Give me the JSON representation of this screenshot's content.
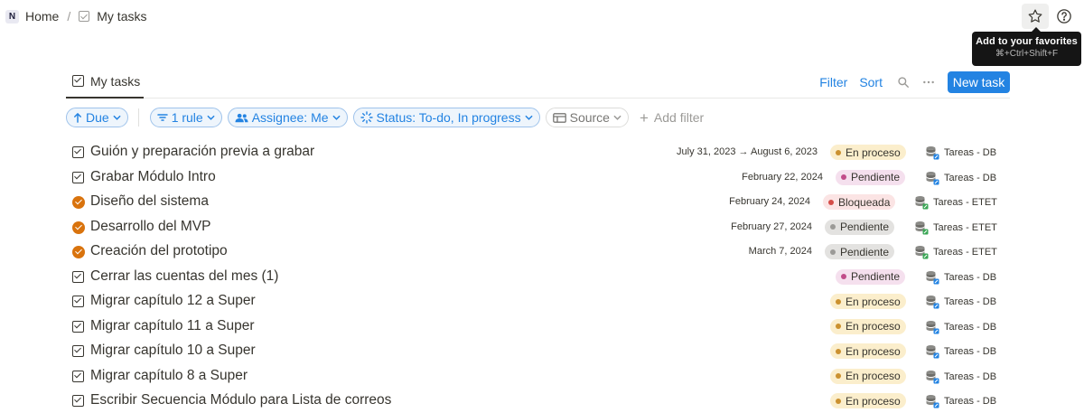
{
  "breadcrumb": {
    "logo": "N",
    "home": "Home",
    "separator": "/",
    "current": "My tasks"
  },
  "tooltip": {
    "title": "Add to your favorites",
    "shortcut": "⌘+Ctrl+Shift+F"
  },
  "view": {
    "tab_label": "My tasks",
    "filter_label": "Filter",
    "sort_label": "Sort",
    "new_task_label": "New task"
  },
  "filters": {
    "sort": "Due",
    "rule": "1 rule",
    "assignee": "Assignee: Me",
    "status": "Status: To-do, In progress",
    "source": "Source",
    "add_filter": "Add filter"
  },
  "colors": {
    "accent": "#2383e2",
    "en_proceso_bg": "#fbeecc",
    "en_proceso_dot": "#cb912f",
    "pendiente_bg": "#f5e0ee",
    "pendiente_dot": "#c14c8a",
    "bloqueada_bg": "#fbe4e4",
    "bloqueada_dot": "#d44c47",
    "pendiente_grey_bg": "#e3e2e0",
    "pendiente_grey_dot": "#9b9a97",
    "task_done_orange": "#d9730d"
  },
  "tasks": [
    {
      "title": "Guión y preparación previa a grabar",
      "icon": "checkbox-icon",
      "date": "July 31, 2023 → August 6, 2023",
      "status": "En proceso",
      "status_style": "en_proceso",
      "source": "Tareas - DB"
    },
    {
      "title": "Grabar Módulo Intro",
      "icon": "checkbox-icon",
      "date": "February 22, 2024",
      "status": "Pendiente",
      "status_style": "pendiente",
      "source": "Tareas - DB"
    },
    {
      "title": "Diseño del sistema",
      "icon": "orange-check-circle-icon",
      "date": "February 24, 2024",
      "status": "Bloqueada",
      "status_style": "bloqueada",
      "source": "Tareas - ETET"
    },
    {
      "title": "Desarrollo del MVP",
      "icon": "orange-check-circle-icon",
      "date": "February 27, 2024",
      "status": "Pendiente",
      "status_style": "pendiente_grey",
      "source": "Tareas - ETET"
    },
    {
      "title": "Creación del prototipo",
      "icon": "orange-check-circle-icon",
      "date": "March 7, 2024",
      "status": "Pendiente",
      "status_style": "pendiente_grey",
      "source": "Tareas - ETET"
    },
    {
      "title": "Cerrar las cuentas del mes (1)",
      "icon": "checkbox-icon",
      "date": "",
      "status": "Pendiente",
      "status_style": "pendiente",
      "source": "Tareas - DB"
    },
    {
      "title": "Migrar capítulo 12 a Super",
      "icon": "checkbox-icon",
      "date": "",
      "status": "En proceso",
      "status_style": "en_proceso",
      "source": "Tareas - DB"
    },
    {
      "title": "Migrar capítulo 11 a Super",
      "icon": "checkbox-icon",
      "date": "",
      "status": "En proceso",
      "status_style": "en_proceso",
      "source": "Tareas - DB"
    },
    {
      "title": "Migrar capítulo 10 a Super",
      "icon": "checkbox-icon",
      "date": "",
      "status": "En proceso",
      "status_style": "en_proceso",
      "source": "Tareas - DB"
    },
    {
      "title": "Migrar capítulo 8 a Super",
      "icon": "checkbox-icon",
      "date": "",
      "status": "En proceso",
      "status_style": "en_proceso",
      "source": "Tareas - DB"
    },
    {
      "title": "Escribir Secuencia Módulo para Lista de correos",
      "icon": "checkbox-icon",
      "date": "",
      "status": "En proceso",
      "status_style": "en_proceso",
      "source": "Tareas - DB"
    }
  ]
}
